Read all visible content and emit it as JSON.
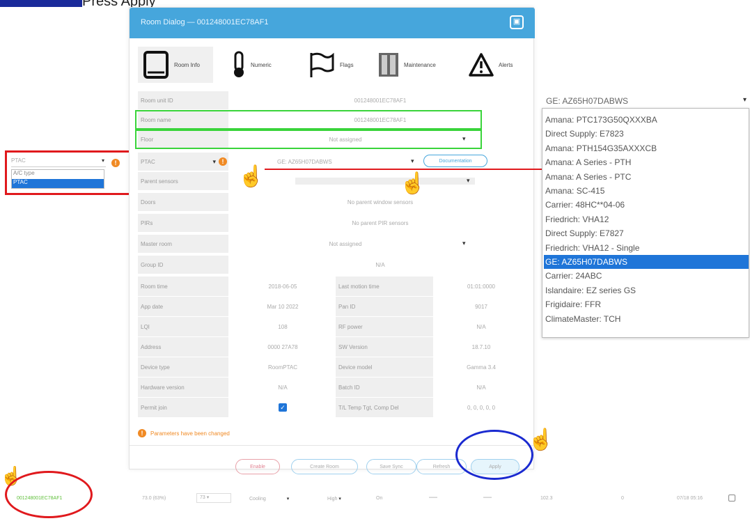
{
  "step": {
    "text": "Press Apply"
  },
  "dialog": {
    "title": "Room Dialog — 001248001EC78AF1",
    "tabs": [
      {
        "label": "Room Info"
      },
      {
        "label": "Numeric"
      },
      {
        "label": "Flags"
      },
      {
        "label": "Maintenance"
      },
      {
        "label": "Alerts"
      }
    ]
  },
  "form": {
    "room_unit_id": {
      "label": "Room unit ID",
      "value": "001248001EC78AF1"
    },
    "room_name": {
      "label": "Room name",
      "value": "001248001EC78AF1"
    },
    "floor": {
      "label": "Floor",
      "value": "Not assigned"
    },
    "ac_type": {
      "label": "PTAC",
      "value": "GE: AZ65H07DABWS",
      "doc_button": "Documentation"
    },
    "parent_sensors": {
      "label": "Parent sensors",
      "value": ""
    },
    "doors": {
      "label": "Doors",
      "value": "No parent window sensors"
    },
    "pirs": {
      "label": "PIRs",
      "value": "No parent PIR sensors"
    },
    "master_room": {
      "label": "Master room",
      "value": "Not assigned"
    },
    "group_id": {
      "label": "Group ID",
      "value": "N/A"
    },
    "stats": [
      {
        "label": "Room time",
        "value": "2018-06-05",
        "label2": "Last motion time",
        "value2": "01:01:0000"
      },
      {
        "label": "App date",
        "value": "Mar 10 2022",
        "label2": "Pan ID",
        "value2": "9017"
      },
      {
        "label": "LQI",
        "value": "108",
        "label2": "RF power",
        "value2": "N/A"
      },
      {
        "label": "Address",
        "value": "0000 27A78",
        "label2": "SW Version",
        "value2": "18.7.10"
      },
      {
        "label": "Device type",
        "value": "RoomPTAC",
        "label2": "Device model",
        "value2": "Gamma 3.4"
      },
      {
        "label": "Hardware version",
        "value": "N/A",
        "label2": "Batch ID",
        "value2": "N/A"
      },
      {
        "label": "Permit join",
        "value": "",
        "label2": "T/L Temp Tgt, Comp Del",
        "value2": "0, 0, 0, 0, 0"
      }
    ],
    "changed_notice": "Parameters have been changed"
  },
  "buttons": [
    {
      "label": "Enable"
    },
    {
      "label": "Create Room"
    },
    {
      "label": "Save Sync"
    },
    {
      "label": "Refresh"
    },
    {
      "label": "Apply"
    }
  ],
  "left_mini": {
    "select_value": "PTAC",
    "options": [
      "A/C type",
      "PTAC"
    ]
  },
  "ac_dropdown": {
    "current": "GE: AZ65H07DABWS",
    "options": [
      "Amana: PTC173G50QXXXBA",
      "Direct Supply: E7823",
      "Amana: PTH154G35AXXXCB",
      "Amana: A Series - PTH",
      "Amana: A Series - PTC",
      "Amana: SC-415",
      "Carrier: 48HC**04-06",
      "Friedrich: VHA12",
      "Direct Supply: E7827",
      "Friedrich: VHA12 - Single",
      "GE: AZ65H07DABWS",
      "Carrier: 24ABC",
      "Islandaire: EZ series GS",
      "Frigidaire: FFR",
      "ClimateMaster: TCH"
    ],
    "selected_index": 10
  },
  "bottom_row": {
    "unit_id": "001248001EC78AF1",
    "temp": "73.0 (63%)",
    "setpoint": "73",
    "mode": "Cooling",
    "fan": "High",
    "power": "On",
    "dash1": "—",
    "dash2": "—",
    "value1": "102.3",
    "value2": "0",
    "date": "07/18 05:16"
  },
  "colors": {
    "header": "#46a6dc",
    "highlight_green": "#39d43a",
    "highlight_red": "#e0191d",
    "highlight_blue": "#1a2ad0",
    "selection": "#1f75d8",
    "warning": "#f08a24"
  }
}
